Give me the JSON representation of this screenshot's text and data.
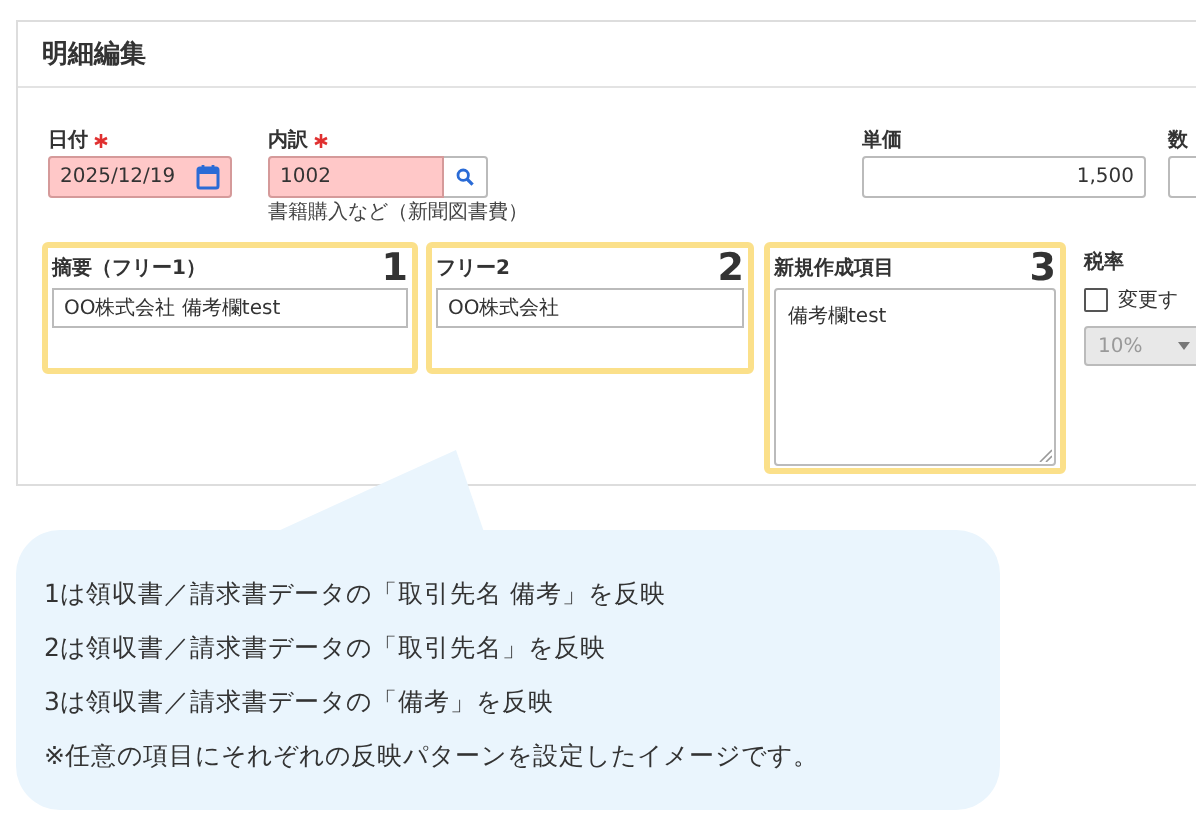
{
  "panel": {
    "title": "明細編集"
  },
  "fields": [
    {
      "kind": "date",
      "label": "日付",
      "required": true,
      "error": true,
      "value": "2025/12/19"
    },
    {
      "kind": "lookup",
      "label": "内訳",
      "required": true,
      "error": true,
      "value": "1002",
      "hint": "書籍購入など（新聞図書費）"
    },
    {
      "kind": "number",
      "label": "単価",
      "required": false,
      "error": false,
      "value": "1,500"
    },
    {
      "kind": "number",
      "label": "数",
      "required": false,
      "error": false
    }
  ],
  "mapped_fields": [
    {
      "kind": "text",
      "label": "摘要（フリー1）",
      "badge": "1",
      "value": "OO株式会社 備考欄test"
    },
    {
      "kind": "text",
      "label": "フリー2",
      "badge": "2",
      "value": "OO株式会社"
    },
    {
      "kind": "textarea",
      "label": "新規作成項目",
      "badge": "3",
      "value": "備考欄test"
    }
  ],
  "tax": {
    "label": "税率",
    "checkbox_label": "変更す",
    "checked": false,
    "rate": "10%",
    "disabled": true
  },
  "callout": {
    "lines": [
      "1は領収書／請求書データの「取引先名 備考」を反映",
      "2は領収書／請求書データの「取引先名」を反映",
      "3は領収書／請求書データの「備考」を反映",
      "※任意の項目にそれぞれの反映パターンを設定したイメージです。"
    ]
  }
}
